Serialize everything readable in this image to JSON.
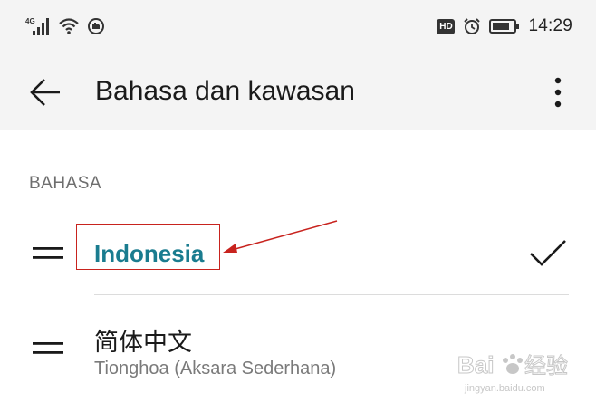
{
  "status_bar": {
    "network": "4G",
    "time": "14:29",
    "hd_badge": "HD"
  },
  "header": {
    "title": "Bahasa dan kawasan",
    "back_icon": "arrow-left-icon",
    "more_icon": "more-vertical-icon"
  },
  "section": {
    "label": "BAHASA"
  },
  "languages": [
    {
      "name": "Indonesia",
      "subtitle": "",
      "selected": true
    },
    {
      "name": "简体中文",
      "subtitle": "Tionghoa (Aksara Sederhana)",
      "selected": false
    }
  ],
  "watermark": {
    "text": "Baidu 经验",
    "url": "jingyan.baidu.com"
  },
  "colors": {
    "accent": "#1a7c8f",
    "annotation": "#c8231e",
    "bar_background": "#f4f4f4"
  }
}
